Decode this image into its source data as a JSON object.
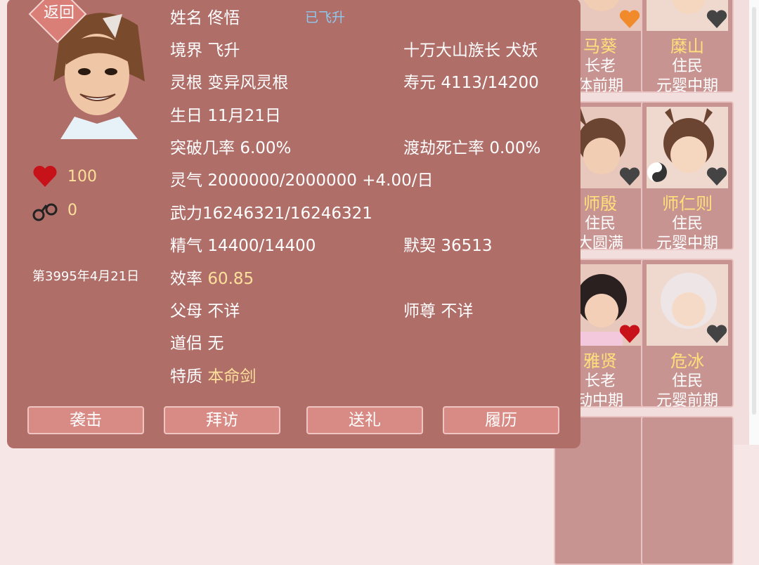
{
  "header": {
    "back_label": "返回"
  },
  "profile": {
    "name_label": "姓名",
    "name": "佟悟",
    "ascended_badge": "已飞升",
    "realm_label": "境界",
    "realm": "飞升",
    "title": "十万大山族长",
    "race": "犬妖",
    "root_label": "灵根",
    "root": "变异风灵根",
    "lifespan_label": "寿元",
    "lifespan": "4113/14200",
    "birthday_label": "生日",
    "birthday": "11月21日",
    "breakthrough_label": "突破几率",
    "breakthrough": "6.00%",
    "tribulation_label": "渡劫死亡率",
    "tribulation": "0.00%",
    "qi_label": "灵气",
    "qi": "2000000/2000000 +4.00/日",
    "force_label": "武力",
    "force": "16246321/16246321",
    "essence_label": "精气",
    "essence": "14400/14400",
    "bond_label": "默契",
    "bond": "36513",
    "efficiency_label": "效率",
    "efficiency": "60.85",
    "parents_label": "父母",
    "parents": "不详",
    "master_label": "师尊",
    "master": "不详",
    "partner_label": "道侣",
    "partner": "无",
    "trait_label": "特质",
    "trait": "本命剑"
  },
  "side_stats": {
    "affection": "100",
    "shackles": "0",
    "date": "第3995年4月21日"
  },
  "actions": {
    "attack": "袭击",
    "visit": "拜访",
    "gift": "送礼",
    "history": "履历"
  },
  "roster": [
    {
      "name": "马葵",
      "role": "长老",
      "stage": "体前期"
    },
    {
      "name": "糜山",
      "role": "住民",
      "stage": "元婴中期"
    },
    {
      "name": "师殷",
      "role": "住民",
      "stage": "大圆满"
    },
    {
      "name": "师仁则",
      "role": "住民",
      "stage": "元婴中期"
    },
    {
      "name": "雅贤",
      "role": "长老",
      "stage": "动中期"
    },
    {
      "name": "危冰",
      "role": "住民",
      "stage": "元婴前期"
    }
  ],
  "colors": {
    "panel": "#b06e69",
    "highlight": "#ffe09a",
    "card": "#c89491"
  }
}
